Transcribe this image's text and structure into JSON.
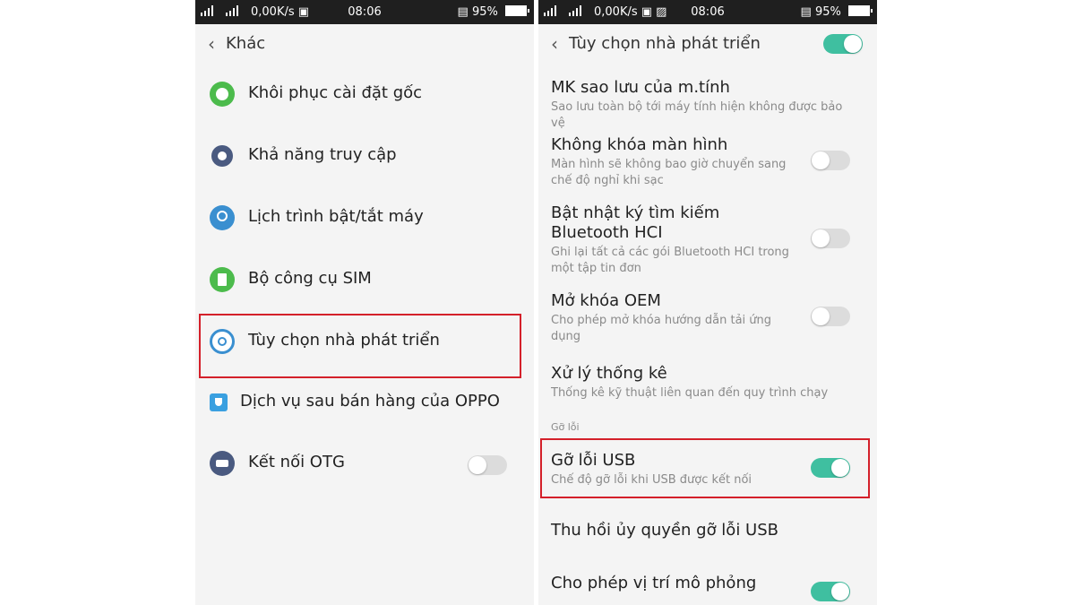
{
  "status_bar": {
    "speed": "0,00K/s",
    "time": "08:06",
    "battery": "95%"
  },
  "left": {
    "back_title": "Khác",
    "items": [
      {
        "label": "Khôi phục cài đặt gốc",
        "icon": "reset-icon",
        "color": "#4cbb4c"
      },
      {
        "label": "Khả năng truy cập",
        "icon": "accessibility-icon",
        "color": "#4a5a80"
      },
      {
        "label": "Lịch trình bật/tắt máy",
        "icon": "schedule-power-icon",
        "color": "#3a8fd0"
      },
      {
        "label": "Bộ công cụ SIM",
        "icon": "sim-toolkit-icon",
        "color": "#4cbb4c"
      },
      {
        "label": "Tùy chọn nhà phát triển",
        "icon": "developer-options-icon",
        "color": "#3a8fd0"
      },
      {
        "label": "Dịch vụ sau bán hàng của OPPO",
        "icon": "oppo-service-icon",
        "color": "#3aa0e0"
      },
      {
        "label": "Kết nối OTG",
        "icon": "otg-icon",
        "color": "#4a5a80",
        "toggle": false
      }
    ]
  },
  "right": {
    "title": "Tùy chọn nhà phát triển",
    "master_toggle": true,
    "settings": [
      {
        "title": "MK sao lưu của m.tính",
        "desc": "Sao lưu toàn bộ tới máy tính hiện không được bảo vệ"
      },
      {
        "title": "Không khóa màn hình",
        "desc": "Màn hình sẽ không bao giờ chuyển sang chế độ nghỉ khi sạc",
        "toggle": false
      },
      {
        "title": "Bật nhật ký tìm kiếm Bluetooth HCI",
        "desc": "Ghi lại tất cả các gói Bluetooth HCI trong một tập tin đơn",
        "toggle": false
      },
      {
        "title": "Mở khóa OEM",
        "desc": "Cho phép mở khóa hướng dẫn tải ứng dụng",
        "toggle": false
      },
      {
        "title": "Xử lý thống kê",
        "desc": "Thống kê kỹ thuật liên quan đến quy trình chạy"
      }
    ],
    "section_debug": "Gỡ lỗi",
    "usb_debug": {
      "title": "Gỡ lỗi USB",
      "desc": "Chế độ gỡ lỗi khi USB được kết nối",
      "toggle": true
    },
    "revoke": {
      "title": "Thu hồi ủy quyền gỡ lỗi USB"
    },
    "mock_location": {
      "title": "Cho phép vị trí mô phỏng",
      "toggle": true
    }
  },
  "colors": {
    "accent_toggle": "#3fbfa0",
    "highlight_border": "#d4202a",
    "status_bar": "#1f1f1f"
  }
}
